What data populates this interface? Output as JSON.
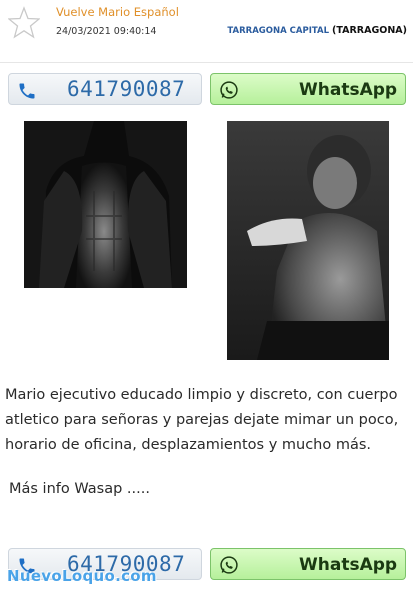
{
  "ad": {
    "title": "Vuelve Mario Español",
    "date": "24/03/2021 09:40:14",
    "location_city": "TARRAGONA CAPITAL",
    "location_province": "(TARRAGONA)"
  },
  "contact": {
    "phone": "641790087",
    "whatsapp_label": "WhatsApp"
  },
  "body": {
    "description": "Mario ejecutivo educado limpio y discreto, con cuerpo atletico para señoras y parejas dejate mimar un poco, horario de oficina, desplazamientos y mucho más.",
    "more_info": "Más info Wasap ....."
  },
  "watermark": "NuevoLoquo.com",
  "icons": {
    "favorite": "star-icon",
    "phone": "phone-icon",
    "whatsapp": "whatsapp-icon"
  },
  "colors": {
    "title": "#e0902a",
    "city": "#2b5c9e",
    "phone_number": "#2d6aa8",
    "whatsapp_bg": "#b6f09b",
    "watermark": "#4aa3e8"
  }
}
